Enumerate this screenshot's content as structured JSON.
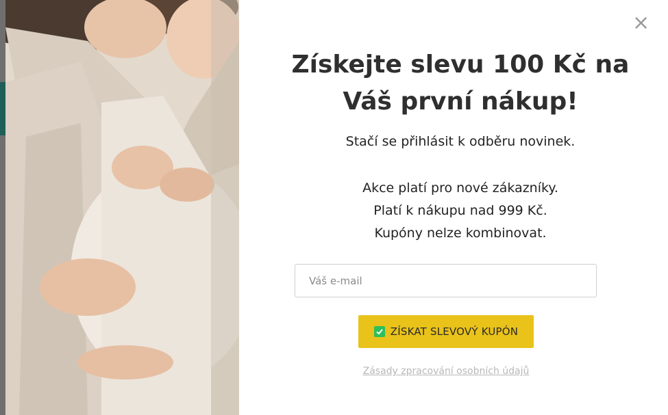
{
  "popup": {
    "title_line1": "Získejte slevu 100 Kč na",
    "title_line2": "Váš první nákup!",
    "subtitle": "Stačí se přihlásit k odběru novinek.",
    "rules": [
      "Akce platí pro nové zákazníky.",
      "Platí k nákupu nad 999 Kč.",
      "Kupóny nelze kombinovat."
    ],
    "email_placeholder": "Váš e-mail",
    "email_value": "",
    "cta_label": "ZÍSKAT SLEVOVÝ KUPÓN",
    "privacy_link": "Zásady zpracování osobních údajů",
    "close_symbol": "×"
  },
  "icons": {
    "close": "close-icon",
    "check": "check-icon"
  },
  "colors": {
    "cta_background": "#e9c21a",
    "check_green": "#2fbf5a",
    "title_text": "#2f2f2f",
    "privacy_link": "#b7b7b7"
  }
}
